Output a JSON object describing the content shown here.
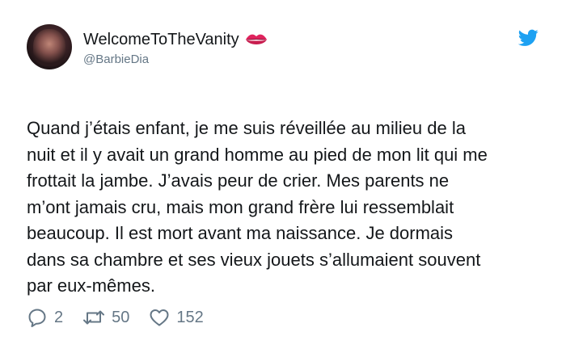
{
  "author": {
    "display_name": "WelcomeToTheVanity",
    "handle": "@BarbieDia",
    "name_emoji": "kiss-mark-icon"
  },
  "tweet": {
    "lines": [
      "Quand j’étais enfant, je me suis réveillée au milieu de la",
      "nuit et il y avait un grand homme au pied de mon lit qui me",
      "frottait la jambe. J’avais peur de crier. Mes parents ne",
      "m’ont jamais cru, mais mon grand frère lui ressemblait",
      "beaucoup. Il est mort avant ma naissance. Je dormais",
      "dans sa chambre et ses vieux jouets s’allumaient souvent",
      "par eux-mêmes."
    ]
  },
  "actions": {
    "replies": "2",
    "retweets": "50",
    "likes": "152"
  },
  "colors": {
    "text": "#14171a",
    "secondary": "#657786",
    "twitter_blue": "#1da1f2",
    "lips": "#e0245e"
  }
}
